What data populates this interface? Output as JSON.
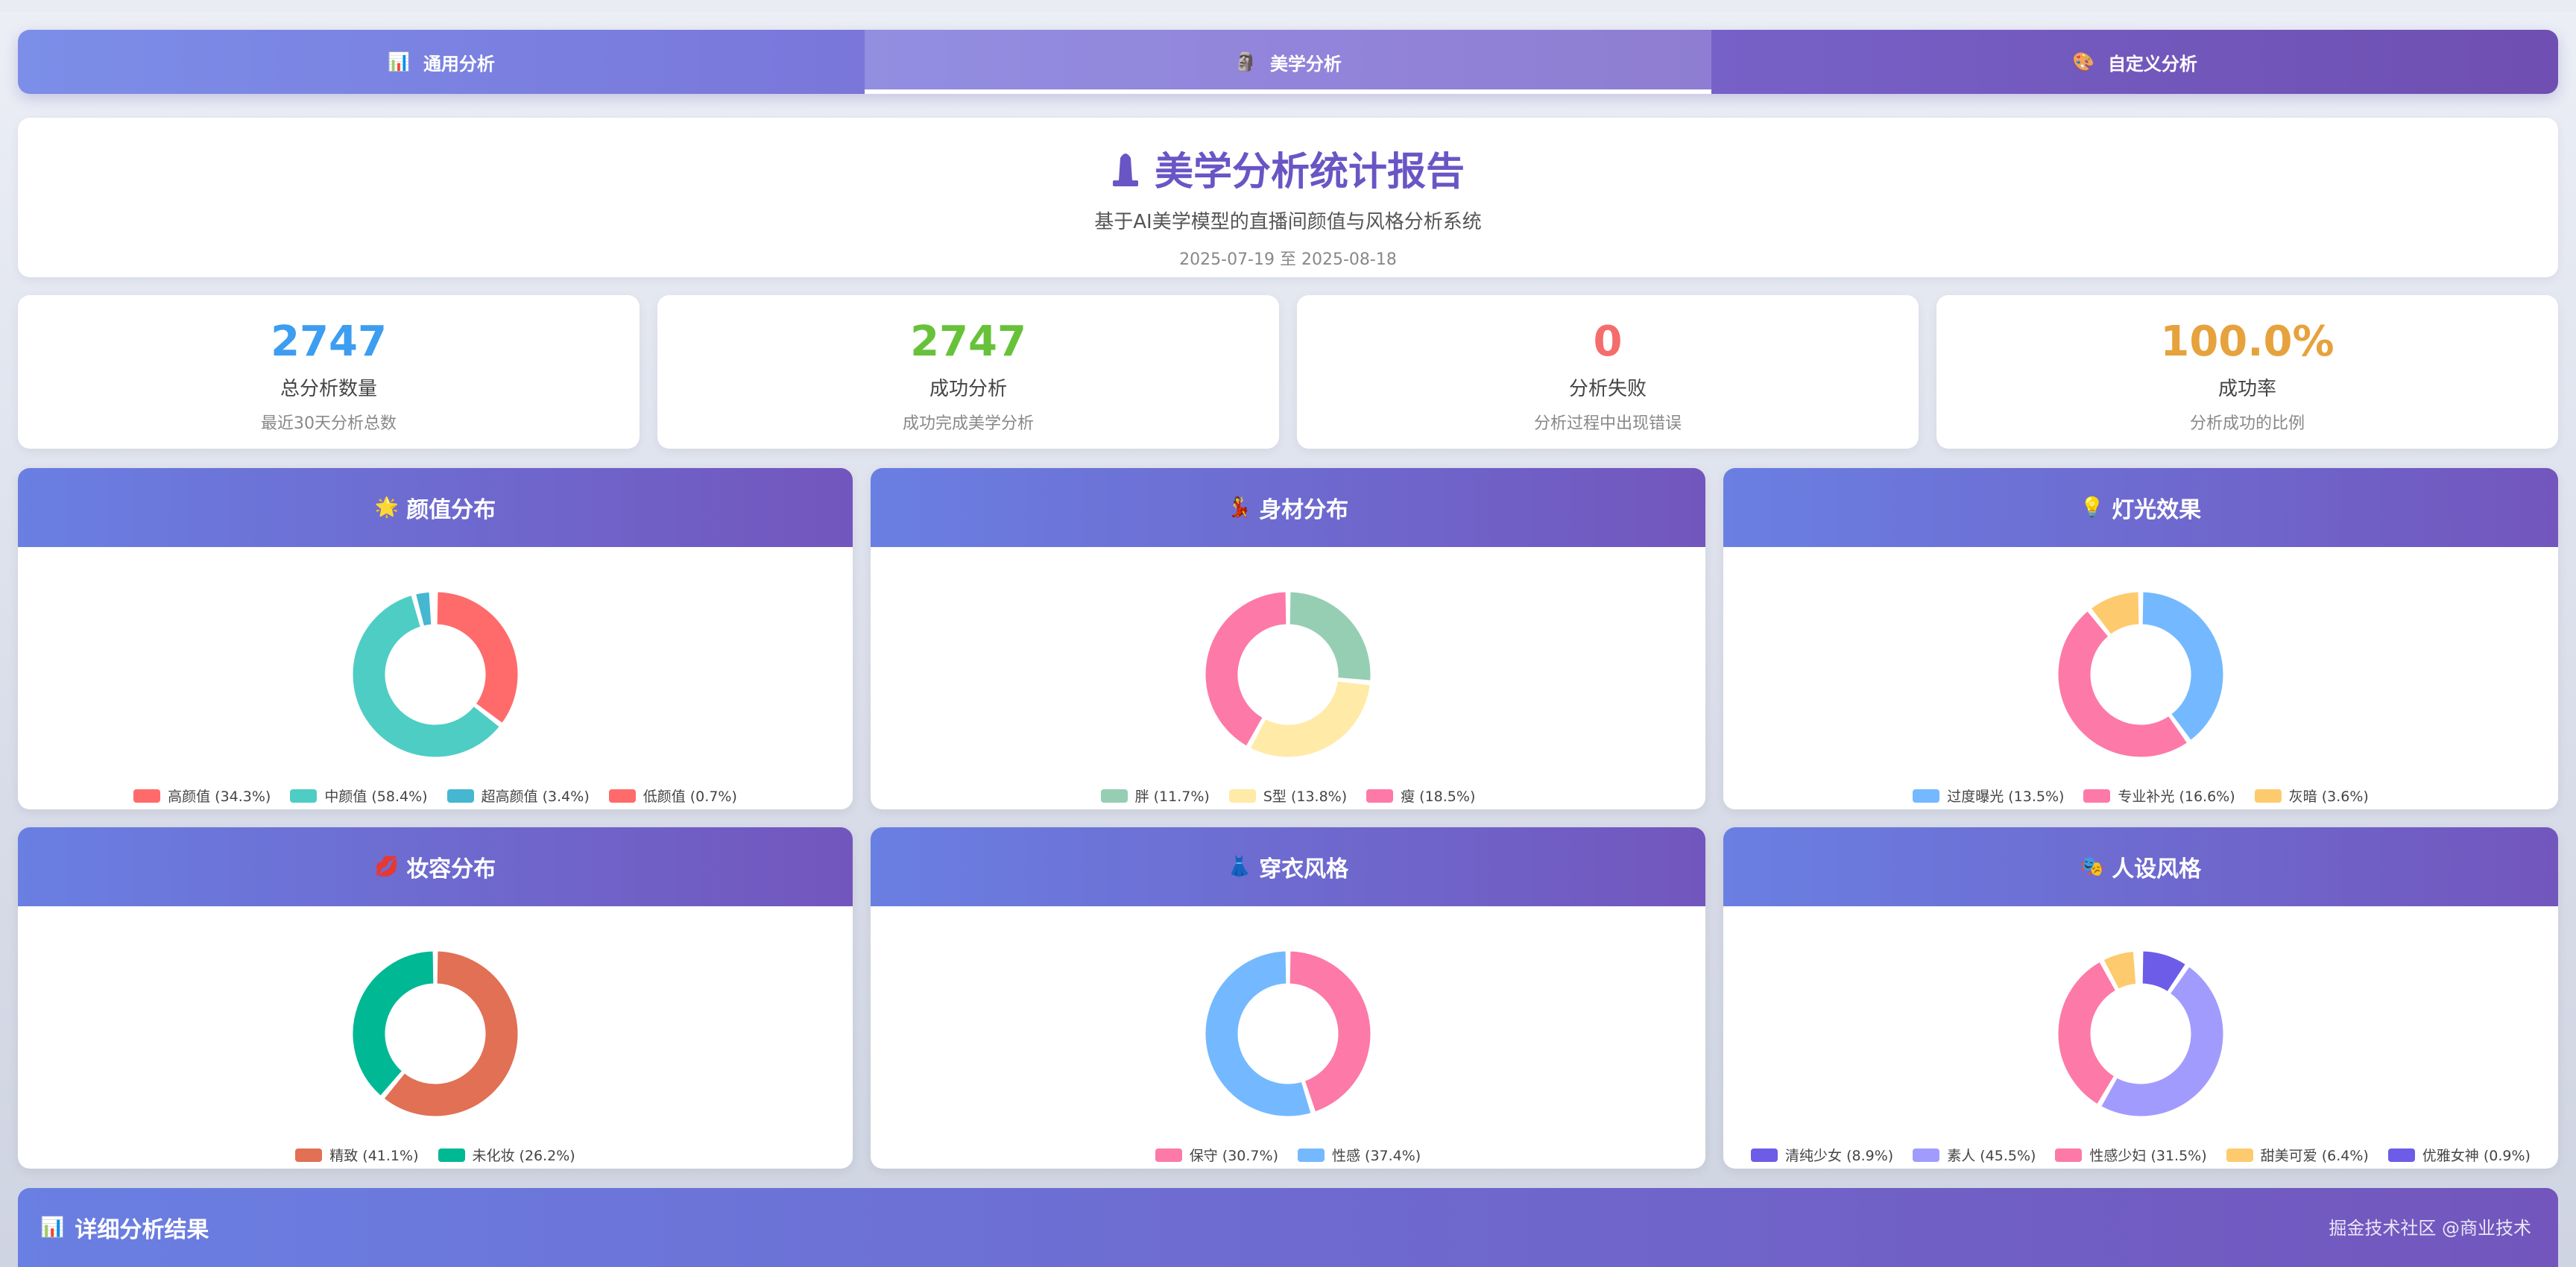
{
  "tabs": [
    {
      "label": "通用分析",
      "icon": "bar-chart-icon",
      "glyph": "📊"
    },
    {
      "label": "美学分析",
      "icon": "statue-icon",
      "glyph": "🗿"
    },
    {
      "label": "自定义分析",
      "icon": "palette-icon",
      "glyph": "🎨"
    }
  ],
  "header": {
    "title": "美学分析统计报告",
    "subtitle": "基于AI美学模型的直播间颜值与风格分析系统",
    "date_range": "2025-07-19 至 2025-08-18"
  },
  "stats": [
    {
      "value": "2747",
      "label": "总分析数量",
      "desc": "最近30天分析总数",
      "color": "#3d9df0"
    },
    {
      "value": "2747",
      "label": "成功分析",
      "desc": "成功完成美学分析",
      "color": "#67c23a"
    },
    {
      "value": "0",
      "label": "分析失败",
      "desc": "分析过程中出现错误",
      "color": "#f56c6c"
    },
    {
      "value": "100.0%",
      "label": "成功率",
      "desc": "分析成功的比例",
      "color": "#e6a23c"
    }
  ],
  "chart_data": [
    {
      "type": "pie",
      "title": "颜值分布",
      "icon": "star-icon",
      "glyph": "🌟",
      "labels": [
        "高颜值 (34.3%)",
        "中颜值 (58.4%)",
        "超高颜值 (3.4%)",
        "低颜值 (0.7%)"
      ],
      "values": [
        34.3,
        58.4,
        3.4,
        0.7
      ],
      "colors": [
        "#ff6b6b",
        "#4ecdc4",
        "#45b7d1",
        "#ff6b6b"
      ]
    },
    {
      "type": "pie",
      "title": "身材分布",
      "icon": "dancer-icon",
      "glyph": "💃",
      "labels": [
        "胖 (11.7%)",
        "S型 (13.8%)",
        "瘦 (18.5%)"
      ],
      "values": [
        11.7,
        13.8,
        18.5
      ],
      "colors": [
        "#96ceb4",
        "#ffeaa7",
        "#fd79a8"
      ]
    },
    {
      "type": "pie",
      "title": "灯光效果",
      "icon": "bulb-icon",
      "glyph": "💡",
      "labels": [
        "过度曝光 (13.5%)",
        "专业补光 (16.6%)",
        "灰暗 (3.6%)"
      ],
      "values": [
        13.5,
        16.6,
        3.6
      ],
      "colors": [
        "#74b9ff",
        "#fd79a8",
        "#fdcb6e"
      ]
    },
    {
      "type": "pie",
      "title": "妆容分布",
      "icon": "lips-icon",
      "glyph": "💋",
      "labels": [
        "精致 (41.1%)",
        "未化妆 (26.2%)"
      ],
      "values": [
        41.1,
        26.2
      ],
      "colors": [
        "#e17055",
        "#00b894"
      ]
    },
    {
      "type": "pie",
      "title": "穿衣风格",
      "icon": "dress-icon",
      "glyph": "👗",
      "labels": [
        "保守 (30.7%)",
        "性感 (37.4%)"
      ],
      "values": [
        30.7,
        37.4
      ],
      "colors": [
        "#fd79a8",
        "#74b9ff"
      ]
    },
    {
      "type": "pie",
      "title": "人设风格",
      "icon": "masks-icon",
      "glyph": "🎭",
      "labels": [
        "清纯少女 (8.9%)",
        "素人 (45.5%)",
        "性感少妇 (31.5%)",
        "甜美可爱 (6.4%)",
        "优雅女神 (0.9%)"
      ],
      "values": [
        8.9,
        45.5,
        31.5,
        6.4,
        0.9
      ],
      "colors": [
        "#6c5ce7",
        "#a29bfe",
        "#fd79a8",
        "#fdcb6e",
        "#6c5ce7"
      ]
    }
  ],
  "details": {
    "title": "详细分析结果",
    "icon": "bar-chart-icon",
    "glyph": "📊"
  },
  "watermark": "掘金技术社区 @商业技术"
}
